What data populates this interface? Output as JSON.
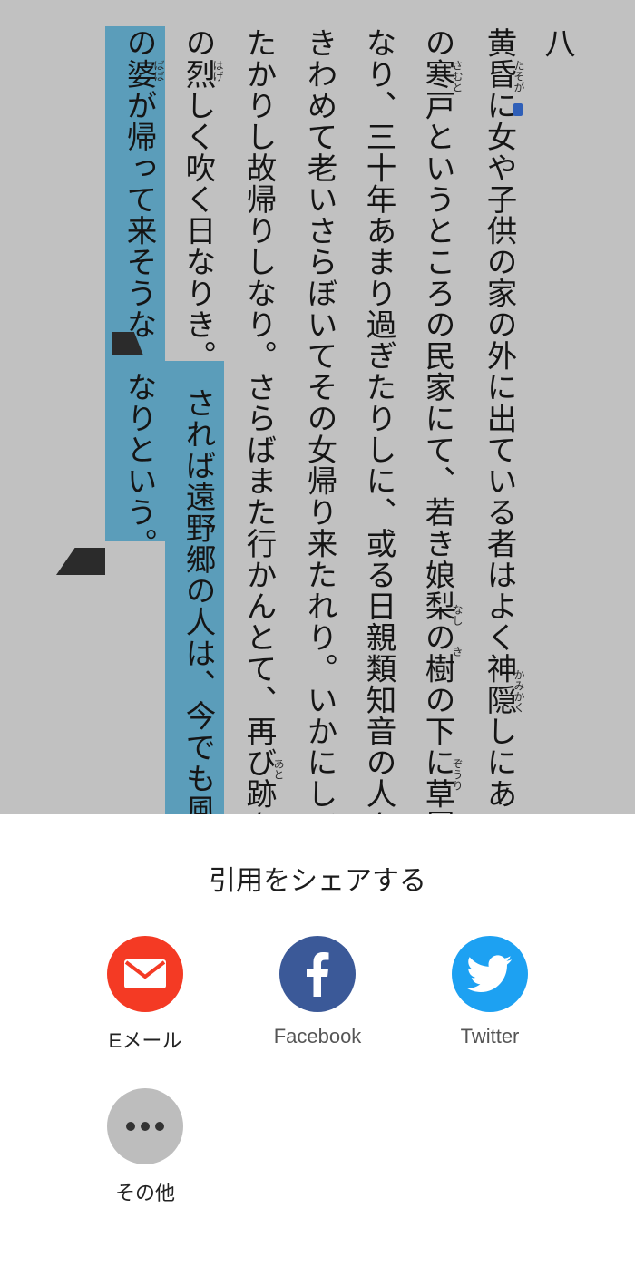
{
  "reader": {
    "chapter": "八",
    "columns": [
      "黄昏に女や子供の家の外に出ている者はよく神隠しにあ",
      "の寒戸というところの民家にて、若き娘梨の樹の下に草履",
      "なり、三十年あまり過ぎたりしに、或る日親類知音の人々",
      "きわめて老いさらぼいてその女帰り来たれり。いかにして",
      "たかりし故帰りしなり。さらばまた行かんとて、再び跡を",
      "の烈しく吹く日なりき。　されば遠野郷の人は、今でも風の",
      "の婆が帰って来そうな　なりという。"
    ],
    "ruby": {
      "tasogare": "たそが",
      "samuto": "さむと",
      "nashi": "なし",
      "ki": "き",
      "kamikaku": "かみかく",
      "zouri": "ぞうり",
      "ato": "あと",
      "hage": "はげ",
      "baba": "ばば"
    }
  },
  "share": {
    "title": "引用をシェアする",
    "items": [
      {
        "label": "Eメール",
        "icon": "mail-icon",
        "color": "#f43a24"
      },
      {
        "label": "Facebook",
        "icon": "facebook-icon",
        "color": "#3b5998"
      },
      {
        "label": "Twitter",
        "icon": "twitter-icon",
        "color": "#1da1f2"
      },
      {
        "label": "その他",
        "icon": "more-icon",
        "color": "#bdbdbd"
      }
    ]
  },
  "colors": {
    "page_background": "#c1c1c1",
    "selection": "#5b9dba"
  }
}
